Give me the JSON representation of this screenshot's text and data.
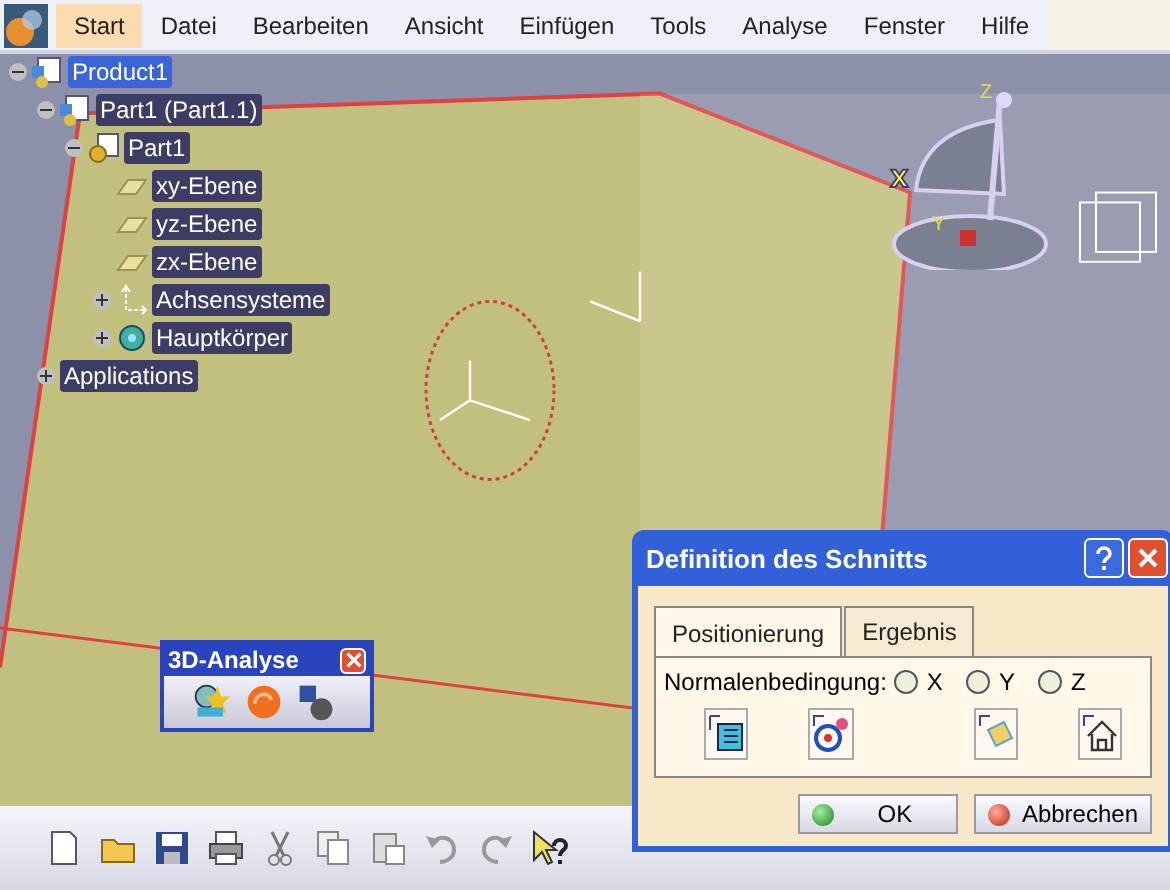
{
  "menu": [
    {
      "label": "Start",
      "selected": true
    },
    {
      "label": "Datei",
      "selected": false
    },
    {
      "label": "Bearbeiten",
      "selected": false
    },
    {
      "label": "Ansicht",
      "selected": false
    },
    {
      "label": "Einfügen",
      "selected": false
    },
    {
      "label": "Tools",
      "selected": false
    },
    {
      "label": "Analyse",
      "selected": false
    },
    {
      "label": "Fenster",
      "selected": false
    },
    {
      "label": "Hilfe",
      "selected": false
    }
  ],
  "tree": [
    {
      "label": "Product1",
      "kind": "product",
      "selected": true,
      "expanded": true,
      "children": [
        {
          "label": "Part1 (Part1.1)",
          "kind": "product",
          "selected": false,
          "expanded": true,
          "children": [
            {
              "label": "Part1",
              "kind": "part",
              "selected": false,
              "expanded": true,
              "children": [
                {
                  "label": "xy-Ebene",
                  "kind": "plane",
                  "selected": false
                },
                {
                  "label": "yz-Ebene",
                  "kind": "plane",
                  "selected": false
                },
                {
                  "label": "zx-Ebene",
                  "kind": "plane",
                  "selected": false
                },
                {
                  "label": "Achsensysteme",
                  "kind": "axis",
                  "selected": false,
                  "expanded": false
                },
                {
                  "label": "Hauptkörper",
                  "kind": "body",
                  "selected": false,
                  "expanded": false
                }
              ]
            }
          ]
        },
        {
          "label": "Applications",
          "kind": "none",
          "selected": false,
          "expanded": false
        }
      ]
    }
  ],
  "compass_labels": [
    "Z",
    "X",
    "Y"
  ],
  "toolbar_3d": {
    "title": "3D-Analyse"
  },
  "dialog": {
    "title": "Definition des Schnitts",
    "tabs": [
      {
        "label": "Positionierung",
        "selected": true
      },
      {
        "label": "Ergebnis",
        "selected": false
      }
    ],
    "normal_label": "Normalenbedingung:",
    "radios": [
      {
        "label": "X",
        "checked": false
      },
      {
        "label": "Y",
        "checked": false
      },
      {
        "label": "Z",
        "checked": false
      }
    ],
    "ok": "OK",
    "cancel": "Abbrechen"
  }
}
